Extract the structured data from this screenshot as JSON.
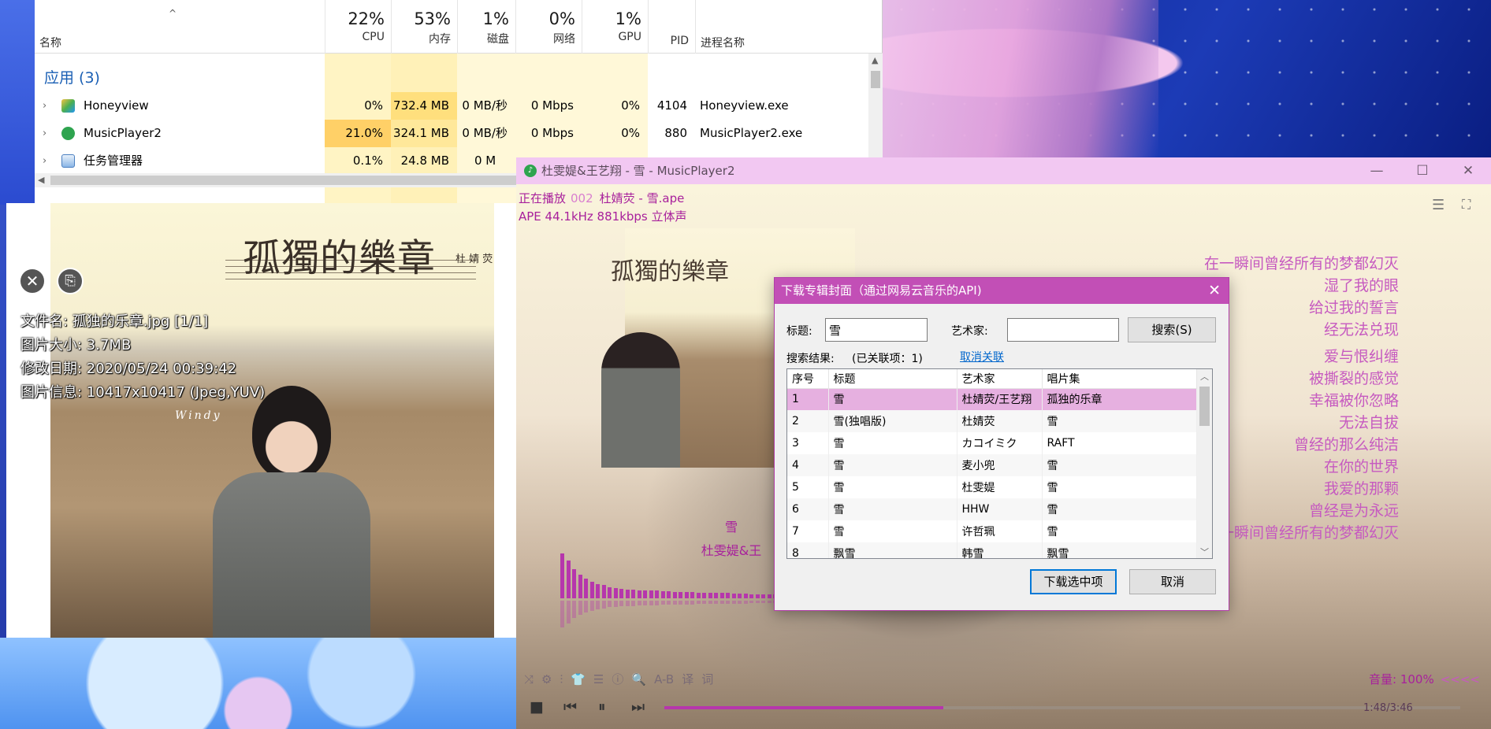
{
  "task_manager": {
    "sort_caret": "^",
    "name_header": "名称",
    "columns": [
      {
        "pct": "22%",
        "label": "CPU"
      },
      {
        "pct": "53%",
        "label": "内存"
      },
      {
        "pct": "1%",
        "label": "磁盘"
      },
      {
        "pct": "0%",
        "label": "网络"
      },
      {
        "pct": "1%",
        "label": "GPU"
      }
    ],
    "pid_header": "PID",
    "proc_header": "进程名称",
    "group_label": "应用 (3)",
    "rows": [
      {
        "name": "Honeyview",
        "cpu": "0%",
        "mem": "732.4 MB",
        "disk": "0 MB/秒",
        "net": "0 Mbps",
        "gpu": "0%",
        "pid": "4104",
        "proc": "Honeyview.exe"
      },
      {
        "name": "MusicPlayer2",
        "cpu": "21.0%",
        "mem": "324.1 MB",
        "disk": "0 MB/秒",
        "net": "0 Mbps",
        "gpu": "0%",
        "pid": "880",
        "proc": "MusicPlayer2.exe"
      },
      {
        "name": "任务管理器",
        "cpu": "0.1%",
        "mem": "24.8 MB",
        "disk": "0 M",
        "net": "",
        "gpu": "",
        "pid": "",
        "proc": ""
      }
    ]
  },
  "image_viewer": {
    "artwork_title": "孤獨的樂章",
    "artwork_artist": "杜 婧 荧",
    "artwork_signature": "Windy",
    "close_glyph": "✕",
    "copy_glyph": "⎘",
    "info": [
      "文件名: 孤独的乐章.jpg [1/1]",
      "图片大小: 3.7MB",
      "修改日期: 2020/05/24 00:39:42",
      "图片信息: 10417x10417 (Jpeg,YUV)"
    ]
  },
  "music_player": {
    "window_title": "杜雯媞&王艺翔 - 雪 - MusicPlayer2",
    "win_controls": {
      "minimize": "—",
      "maximize": "☐",
      "close": "✕"
    },
    "now_playing_label": "正在播放",
    "track_number": "002",
    "file_name": "杜婧荧 - 雪.ape",
    "format_info": "APE 44.1kHz 881kbps 立体声",
    "menu_glyph": "☰",
    "fullscreen_glyph": "⛶",
    "cover_title": "孤獨的樂章",
    "song_title": "雪",
    "song_artist": "杜雯媞&王",
    "lyrics": [
      "在一瞬间曾经所有的梦都幻灭",
      "湿了我的眼",
      "给过我的誓言",
      "经无法兑现",
      "爱与恨纠缠",
      "被撕裂的感觉",
      "幸福被你忽略",
      "无法自拔",
      "曾经的那么纯洁",
      "在你的世界",
      "我爱的那颗",
      "曾经是为永远",
      "在一瞬间曾经所有的梦都幻灭"
    ],
    "spectrum": [
      0.95,
      0.8,
      0.62,
      0.5,
      0.42,
      0.35,
      0.3,
      0.28,
      0.24,
      0.22,
      0.2,
      0.19,
      0.18,
      0.17,
      0.17,
      0.16,
      0.16,
      0.15,
      0.15,
      0.14,
      0.14,
      0.13,
      0.13,
      0.12,
      0.12,
      0.12,
      0.11,
      0.11,
      0.11,
      0.1,
      0.1,
      0.1,
      0.09,
      0.09,
      0.09,
      0.09,
      0.08,
      0.08,
      0.08,
      0.08,
      0.07,
      0.07,
      0.07,
      0.07,
      0.06,
      0.06,
      0.06,
      0.06,
      0.05,
      0.05,
      0.05,
      0.05,
      0.04,
      0.04,
      0.04,
      0.04,
      0.04,
      0.03,
      0.03,
      0.03,
      0.03,
      0.03,
      0.02,
      0.02
    ],
    "tools": [
      "⤨",
      "⚙",
      "⫶",
      "👕",
      "☰",
      "ⓘ",
      "🔍",
      "A-B",
      "译",
      "词"
    ],
    "volume_label": "音量: 100%",
    "volume_arrows": "<<<<",
    "controls": {
      "stop": "■",
      "prev": "⏮",
      "pause": "⏸",
      "next": "⏭"
    },
    "progress": 0.35,
    "time": "1:48/3:46"
  },
  "dialog": {
    "title": "下载专辑封面（通过网易云音乐的API)",
    "close_glyph": "✕",
    "title_label": "标题:",
    "title_value": "雪",
    "artist_label": "艺术家:",
    "artist_value": "",
    "search_button": "搜索(S)",
    "results_label": "搜索结果:",
    "linked_label": "(已关联项：1)",
    "unlink_link": "取消关联",
    "headers": [
      "序号",
      "标题",
      "艺术家",
      "唱片集"
    ],
    "rows": [
      [
        "1",
        "雪",
        "杜婧荧/王艺翔",
        "孤独的乐章"
      ],
      [
        "2",
        "雪(独唱版)",
        "杜婧荧",
        "雪"
      ],
      [
        "3",
        "雪",
        "カコイミク",
        "RAFT"
      ],
      [
        "4",
        "雪",
        "麦小兜",
        "雪"
      ],
      [
        "5",
        "雪",
        "杜雯媞",
        "雪"
      ],
      [
        "6",
        "雪",
        "HHW",
        "雪"
      ],
      [
        "7",
        "雪",
        "许哲珮",
        "雪"
      ],
      [
        "8",
        "飘雪",
        "韩雪",
        "飘雪"
      ]
    ],
    "scroll_up": "︿",
    "scroll_down": "﹀",
    "download_button": "下载选中项",
    "cancel_button": "取消"
  }
}
